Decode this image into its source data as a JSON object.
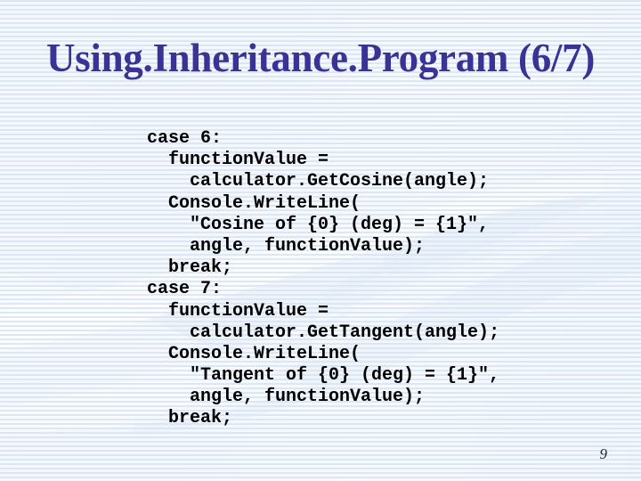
{
  "slide": {
    "title": "Using.Inheritance.Program (6/7)",
    "page_number": "9",
    "colors": {
      "title": "#3a3294",
      "code_text": "#000000",
      "background_stripe_light": "#f4f8fc",
      "background_stripe_blue": "#dbe5f3",
      "background_base": "#eef4fb"
    }
  },
  "code": {
    "language": "csharp",
    "lines": [
      "case 6:",
      "  functionValue =",
      "    calculator.GetCosine(angle);",
      "  Console.WriteLine(",
      "    \"Cosine of {0} (deg) = {1}\",",
      "    angle, functionValue);",
      "  break;",
      "case 7:",
      "  functionValue =",
      "    calculator.GetTangent(angle);",
      "  Console.WriteLine(",
      "    \"Tangent of {0} (deg) = {1}\",",
      "    angle, functionValue);",
      "  break;"
    ]
  }
}
